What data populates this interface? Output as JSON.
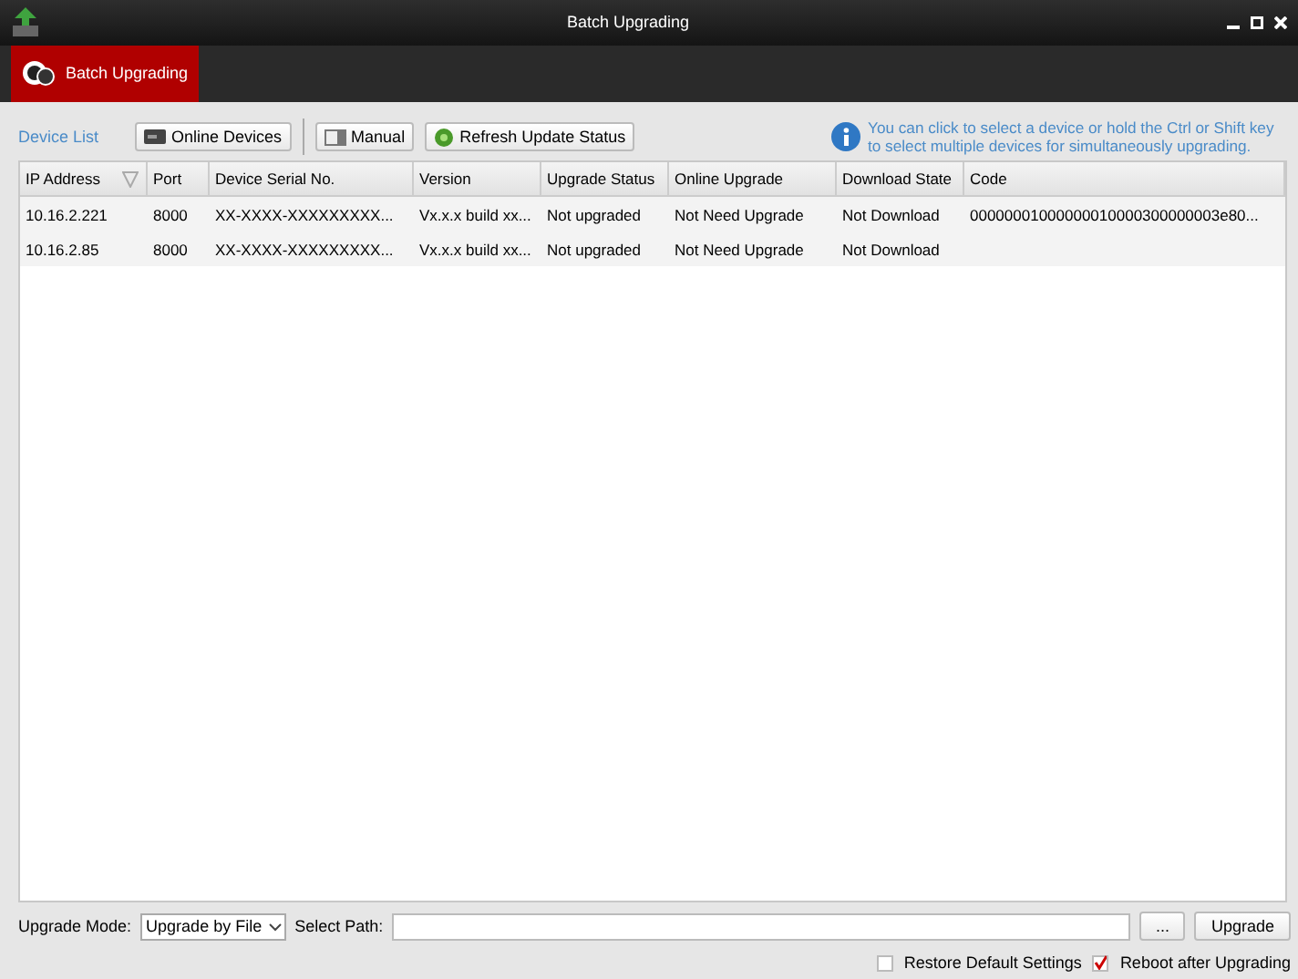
{
  "window": {
    "title": "Batch Upgrading"
  },
  "tabs": [
    {
      "label": "Batch Upgrading",
      "selected": true
    }
  ],
  "toolbar": {
    "title": "Device List",
    "buttons": [
      {
        "label": "Online Devices",
        "kind": "devices"
      },
      {
        "label": "Manual",
        "kind": "manual"
      },
      {
        "label": "Refresh Update Status",
        "kind": "refresh"
      }
    ],
    "hint": "You can click to select a device or hold the Ctrl or Shift key to select multiple devices for simultaneously upgrading."
  },
  "table": {
    "columns": [
      "IP Address",
      "Port",
      "Device Serial No.",
      "Version",
      "Upgrade Status",
      "Online Upgrade",
      "Download State",
      "Code"
    ],
    "rows": [
      [
        "10.16.2.221",
        "8000",
        "XX-XXXX-XXXXXXXXX...",
        "Vx.x.x build xx...",
        "Not upgraded",
        "Not Need Upgrade",
        "Not Download",
        "00000001000000010000300000003e80..."
      ],
      [
        "10.16.2.85",
        "8000",
        "XX-XXXX-XXXXXXXXX...",
        "Vx.x.x build xx...",
        "Not upgraded",
        "Not Need Upgrade",
        "Not Download",
        ""
      ]
    ]
  },
  "footer": {
    "mode_label": "Upgrade Mode:",
    "mode_value": "Upgrade by File",
    "path_label": "Select Path:",
    "browse": "...",
    "upgrade": "Upgrade",
    "options": [
      {
        "label": "Restore Default Settings",
        "checked": false
      },
      {
        "label": "Reboot after Upgrading",
        "checked": true
      }
    ]
  }
}
